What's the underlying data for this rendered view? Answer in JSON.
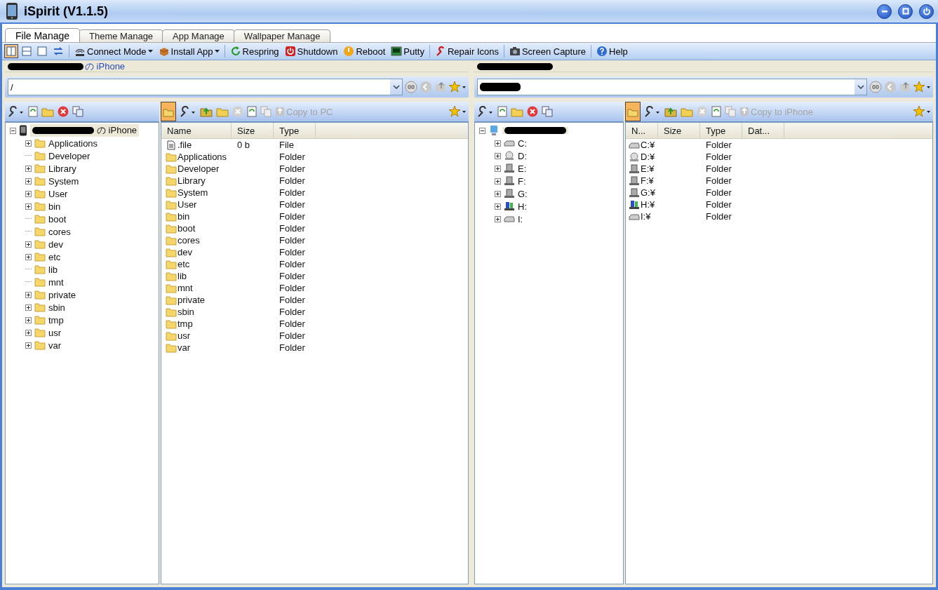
{
  "window": {
    "title": "iSpirit (V1.1.5)"
  },
  "tabs": [
    {
      "label": "File Manage",
      "selected": true
    },
    {
      "label": "Theme Manage",
      "selected": false
    },
    {
      "label": "App Manage",
      "selected": false
    },
    {
      "label": "Wallpaper Manage",
      "selected": false
    }
  ],
  "toolbar": {
    "views": [
      {
        "selected": true
      },
      {
        "selected": false
      },
      {
        "selected": false
      }
    ],
    "items": [
      {
        "kind": "wifi",
        "label": "Connect Mode",
        "dropdown": true
      },
      {
        "kind": "box",
        "label": "Install App",
        "dropdown": true
      },
      {
        "kind": "respring",
        "label": "Respring",
        "dropdown": false
      },
      {
        "kind": "power",
        "label": "Shutdown",
        "dropdown": false
      },
      {
        "kind": "reboot",
        "label": "Reboot",
        "dropdown": false
      },
      {
        "kind": "terminal",
        "label": "Putty",
        "dropdown": false
      },
      {
        "kind": "wrench",
        "label": "Repair Icons",
        "dropdown": false
      },
      {
        "kind": "camera",
        "label": "Screen Capture",
        "dropdown": false
      },
      {
        "kind": "help",
        "label": "Help",
        "dropdown": false
      }
    ]
  },
  "panes": [
    {
      "title": "の iPhone",
      "title_redacted": true,
      "path": "/",
      "folder_view_on": true,
      "copy_button": {
        "label": "Copy to PC",
        "disabled": true
      },
      "tree": {
        "kind": "phone",
        "label": "の iPhone",
        "redacted": true,
        "expanded": true,
        "children": [
          {
            "label": "Applications",
            "kind": "folder",
            "expandable": true
          },
          {
            "label": "Developer",
            "kind": "folder",
            "expandable": false
          },
          {
            "label": "Library",
            "kind": "folder",
            "expandable": true
          },
          {
            "label": "System",
            "kind": "folder",
            "expandable": true
          },
          {
            "label": "User",
            "kind": "folder",
            "expandable": true
          },
          {
            "label": "bin",
            "kind": "folder",
            "expandable": true
          },
          {
            "label": "boot",
            "kind": "folder",
            "expandable": false
          },
          {
            "label": "cores",
            "kind": "folder",
            "expandable": false
          },
          {
            "label": "dev",
            "kind": "folder",
            "expandable": true
          },
          {
            "label": "etc",
            "kind": "folder",
            "expandable": true
          },
          {
            "label": "lib",
            "kind": "folder",
            "expandable": false
          },
          {
            "label": "mnt",
            "kind": "folder",
            "expandable": false
          },
          {
            "label": "private",
            "kind": "folder",
            "expandable": true
          },
          {
            "label": "sbin",
            "kind": "folder",
            "expandable": true
          },
          {
            "label": "tmp",
            "kind": "folder",
            "expandable": true
          },
          {
            "label": "usr",
            "kind": "folder",
            "expandable": true
          },
          {
            "label": "var",
            "kind": "folder",
            "expandable": true
          }
        ]
      },
      "columns": [
        "Name",
        "Size",
        "Type"
      ],
      "rows": [
        {
          "kind": "file",
          "name": ".file",
          "size": "0 b",
          "type": "File"
        },
        {
          "kind": "folder",
          "name": "Applications",
          "type": "Folder"
        },
        {
          "kind": "folder",
          "name": "Developer",
          "type": "Folder"
        },
        {
          "kind": "folder",
          "name": "Library",
          "type": "Folder"
        },
        {
          "kind": "folder",
          "name": "System",
          "type": "Folder"
        },
        {
          "kind": "folder",
          "name": "User",
          "type": "Folder"
        },
        {
          "kind": "folder",
          "name": "bin",
          "type": "Folder"
        },
        {
          "kind": "folder",
          "name": "boot",
          "type": "Folder"
        },
        {
          "kind": "folder",
          "name": "cores",
          "type": "Folder"
        },
        {
          "kind": "folder",
          "name": "dev",
          "type": "Folder"
        },
        {
          "kind": "folder",
          "name": "etc",
          "type": "Folder"
        },
        {
          "kind": "folder",
          "name": "lib",
          "type": "Folder"
        },
        {
          "kind": "folder",
          "name": "mnt",
          "type": "Folder"
        },
        {
          "kind": "folder",
          "name": "private",
          "type": "Folder"
        },
        {
          "kind": "folder",
          "name": "sbin",
          "type": "Folder"
        },
        {
          "kind": "folder",
          "name": "tmp",
          "type": "Folder"
        },
        {
          "kind": "folder",
          "name": "usr",
          "type": "Folder"
        },
        {
          "kind": "folder",
          "name": "var",
          "type": "Folder"
        }
      ]
    },
    {
      "title_redacted": true,
      "path_redacted": true,
      "folder_view_on": true,
      "copy_button": {
        "label": "Copy to iPhone",
        "disabled": true
      },
      "tree": {
        "kind": "computer",
        "redacted": true,
        "expanded": true,
        "children": [
          {
            "label": "C:",
            "kind": "hdd",
            "expandable": true
          },
          {
            "label": "D:",
            "kind": "cd",
            "expandable": true
          },
          {
            "label": "E:",
            "kind": "device",
            "expandable": true
          },
          {
            "label": "F:",
            "kind": "device",
            "expandable": true
          },
          {
            "label": "G:",
            "kind": "device",
            "expandable": true
          },
          {
            "label": "H:",
            "kind": "media",
            "expandable": true
          },
          {
            "label": "I:",
            "kind": "hdd",
            "expandable": true
          }
        ]
      },
      "columns": [
        "N...",
        "Size",
        "Type",
        "Dat..."
      ],
      "rows": [
        {
          "kind": "hdd",
          "name": "C:¥",
          "type": "Folder"
        },
        {
          "kind": "cd",
          "name": "D:¥",
          "type": "Folder"
        },
        {
          "kind": "device",
          "name": "E:¥",
          "type": "Folder"
        },
        {
          "kind": "device",
          "name": "F:¥",
          "type": "Folder"
        },
        {
          "kind": "device",
          "name": "G:¥",
          "type": "Folder"
        },
        {
          "kind": "media",
          "name": "H:¥",
          "type": "Folder"
        },
        {
          "kind": "hdd",
          "name": "I:¥",
          "type": "Folder"
        }
      ]
    }
  ]
}
